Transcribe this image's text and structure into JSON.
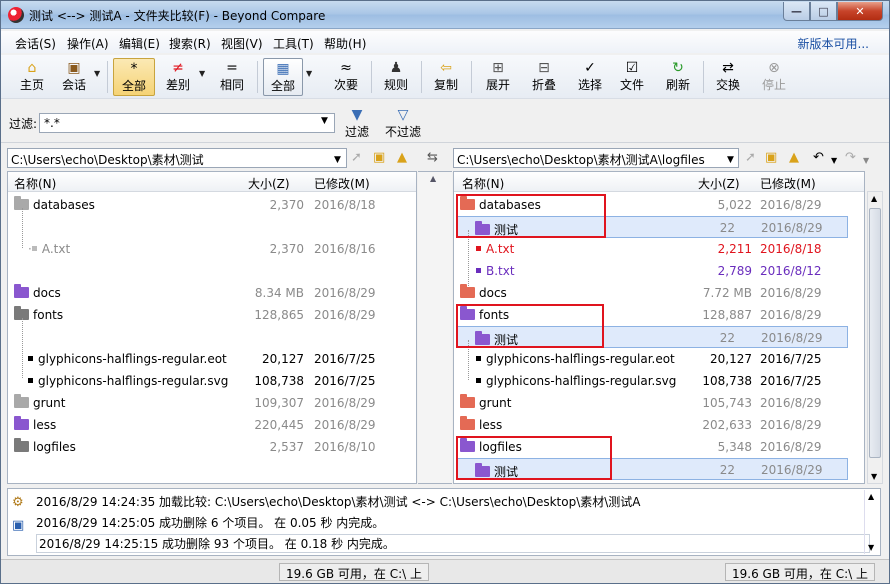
{
  "window": {
    "title": "测试 <--> 测试A - 文件夹比较(F) - Beyond Compare"
  },
  "menu": {
    "items": [
      "会话(S)",
      "操作(A)",
      "编辑(E)",
      "搜索(R)",
      "视图(V)",
      "工具(T)",
      "帮助(H)"
    ],
    "new_version": "新版本可用..."
  },
  "toolbar": {
    "home": "主页",
    "session": "会话",
    "all": "全部",
    "diff": "差别",
    "same": "相同",
    "all2": "全部",
    "minor": "次要",
    "rules": "规则",
    "copy": "复制",
    "expand": "展开",
    "collapse": "折叠",
    "select": "选择",
    "files": "文件",
    "refresh": "刷新",
    "swap": "交换",
    "stop": "停止"
  },
  "filter": {
    "label": "过滤:",
    "value": "*.*",
    "filter_btn": "过滤",
    "nofilter_btn": "不过滤"
  },
  "left": {
    "path": "C:\\Users\\echo\\Desktop\\素材\\测试",
    "headers": {
      "name": "名称(N)",
      "size": "大小(Z)",
      "modified": "已修改(M)"
    },
    "rows": [
      {
        "name": "databases",
        "size": "2,370",
        "date": "2016/8/18"
      },
      {
        "name": "A.txt",
        "size": "2,370",
        "date": "2016/8/16"
      },
      {
        "name": "docs",
        "size": "8.34 MB",
        "date": "2016/8/29"
      },
      {
        "name": "fonts",
        "size": "128,865",
        "date": "2016/8/29"
      },
      {
        "name": "glyphicons-halflings-regular.eot",
        "size": "20,127",
        "date": "2016/7/25"
      },
      {
        "name": "glyphicons-halflings-regular.svg",
        "size": "108,738",
        "date": "2016/7/25"
      },
      {
        "name": "grunt",
        "size": "109,307",
        "date": "2016/8/29"
      },
      {
        "name": "less",
        "size": "220,445",
        "date": "2016/8/29"
      },
      {
        "name": "logfiles",
        "size": "2,537",
        "date": "2016/8/10"
      }
    ]
  },
  "right": {
    "path": "C:\\Users\\echo\\Desktop\\素材\\测试A\\logfiles",
    "headers": {
      "name": "名称(N)",
      "size": "大小(Z)",
      "modified": "已修改(M)"
    },
    "rows": [
      {
        "name": "databases",
        "size": "5,022",
        "date": "2016/8/29"
      },
      {
        "name": "测试",
        "size": "22",
        "date": "2016/8/29"
      },
      {
        "name": "A.txt",
        "size": "2,211",
        "date": "2016/8/18"
      },
      {
        "name": "B.txt",
        "size": "2,789",
        "date": "2016/8/12"
      },
      {
        "name": "docs",
        "size": "7.72 MB",
        "date": "2016/8/29"
      },
      {
        "name": "fonts",
        "size": "128,887",
        "date": "2016/8/29"
      },
      {
        "name": "测试",
        "size": "22",
        "date": "2016/8/29"
      },
      {
        "name": "glyphicons-halflings-regular.eot",
        "size": "20,127",
        "date": "2016/7/25"
      },
      {
        "name": "glyphicons-halflings-regular.svg",
        "size": "108,738",
        "date": "2016/7/25"
      },
      {
        "name": "grunt",
        "size": "105,743",
        "date": "2016/8/29"
      },
      {
        "name": "less",
        "size": "202,633",
        "date": "2016/8/29"
      },
      {
        "name": "logfiles",
        "size": "5,348",
        "date": "2016/8/29"
      },
      {
        "name": "测试",
        "size": "22",
        "date": "2016/8/29"
      }
    ]
  },
  "log": [
    "2016/8/29 14:24:35  加载比较: C:\\Users\\echo\\Desktop\\素材\\测试 <-> C:\\Users\\echo\\Desktop\\素材\\测试A",
    "2016/8/29 14:25:05  成功删除 6 个项目。  在 0.05 秒 内完成。",
    "2016/8/29 14:25:15  成功删除 93 个项目。  在 0.18 秒 内完成。"
  ],
  "status": {
    "left": "19.6 GB 可用，在 C:\\ 上",
    "right": "19.6 GB 可用，在 C:\\ 上"
  },
  "colors": {
    "red": "#e0141e",
    "purple": "#6a2dbd",
    "gray": "#8a8a8a",
    "selection": "#dfeafb"
  }
}
